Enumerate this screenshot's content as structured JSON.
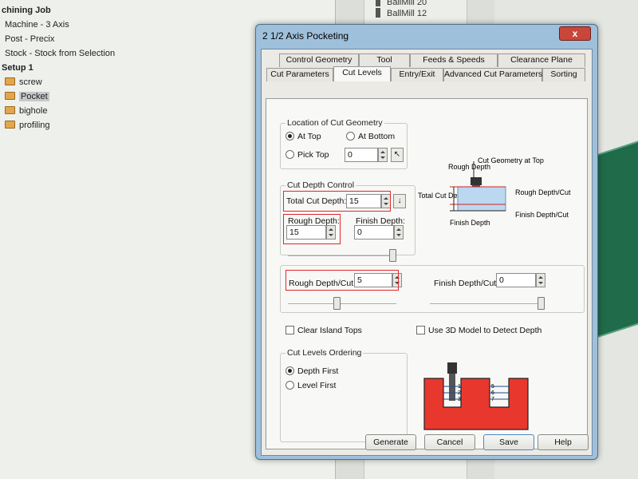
{
  "tree": {
    "job": "chining Job",
    "machine": "Machine - 3 Axis",
    "post": "Post - Precix",
    "stock": "Stock - Stock from Selection",
    "setup": "Setup 1",
    "operations": [
      "screw",
      "Pocket",
      "bighole",
      "profiling"
    ],
    "selected": "Pocket"
  },
  "tools": {
    "items": [
      "BallMill 20",
      "BallMill 12"
    ]
  },
  "dialog": {
    "title": "2 1/2 Axis Pocketing",
    "close_glyph": "x",
    "tabs_back": [
      "Control Geometry",
      "Tool",
      "Feeds & Speeds",
      "Clearance Plane"
    ],
    "tabs_front": [
      "Cut Parameters",
      "Cut Levels",
      "Entry/Exit",
      "Advanced Cut Parameters",
      "Sorting"
    ],
    "active_tab": "Cut Levels",
    "location": {
      "title": "Location of Cut Geometry",
      "at_top": "At Top",
      "at_bottom": "At Bottom",
      "pick_top": "Pick Top",
      "pick_top_value": "0",
      "selected": "At Top"
    },
    "cut_depth": {
      "title": "Cut Depth Control",
      "total_label": "Total Cut Depth:",
      "total_value": "15",
      "rough_label": "Rough Depth:",
      "rough_value": "15",
      "finish_label": "Finish Depth:",
      "finish_value": "0",
      "rough_slider": 1.0
    },
    "per_cut": {
      "rough_label": "Rough Depth/Cut:",
      "rough_value": "5",
      "finish_label": "Finish Depth/Cut:",
      "finish_value": "0",
      "rough_slider": 0.45,
      "finish_slider": 1.0
    },
    "diagram_top": {
      "cut_geometry": "Cut Geometry at Top",
      "rough_depth": "Rough Depth",
      "total_cut_depth": "Total Cut Depth",
      "finish_depth": "Finish Depth",
      "rough_per_cut": "Rough Depth/Cut",
      "finish_per_cut": "Finish Depth/Cut"
    },
    "clear_island": "Clear Island Tops",
    "use_3d": "Use 3D Model to Detect Depth",
    "ordering": {
      "title": "Cut Levels Ordering",
      "depth_first": "Depth First",
      "level_first": "Level First",
      "selected": "Depth First"
    },
    "diagram_order": {
      "left_numbers": [
        "1",
        "2",
        "3"
      ],
      "right_numbers": [
        "5",
        "6",
        "7"
      ]
    },
    "buttons": {
      "generate": "Generate",
      "cancel": "Cancel",
      "save": "Save",
      "help": "Help"
    }
  },
  "colors": {
    "highlight": "#e0282a",
    "part": "#e8382e",
    "dialog_frame": "#9fc0db"
  }
}
